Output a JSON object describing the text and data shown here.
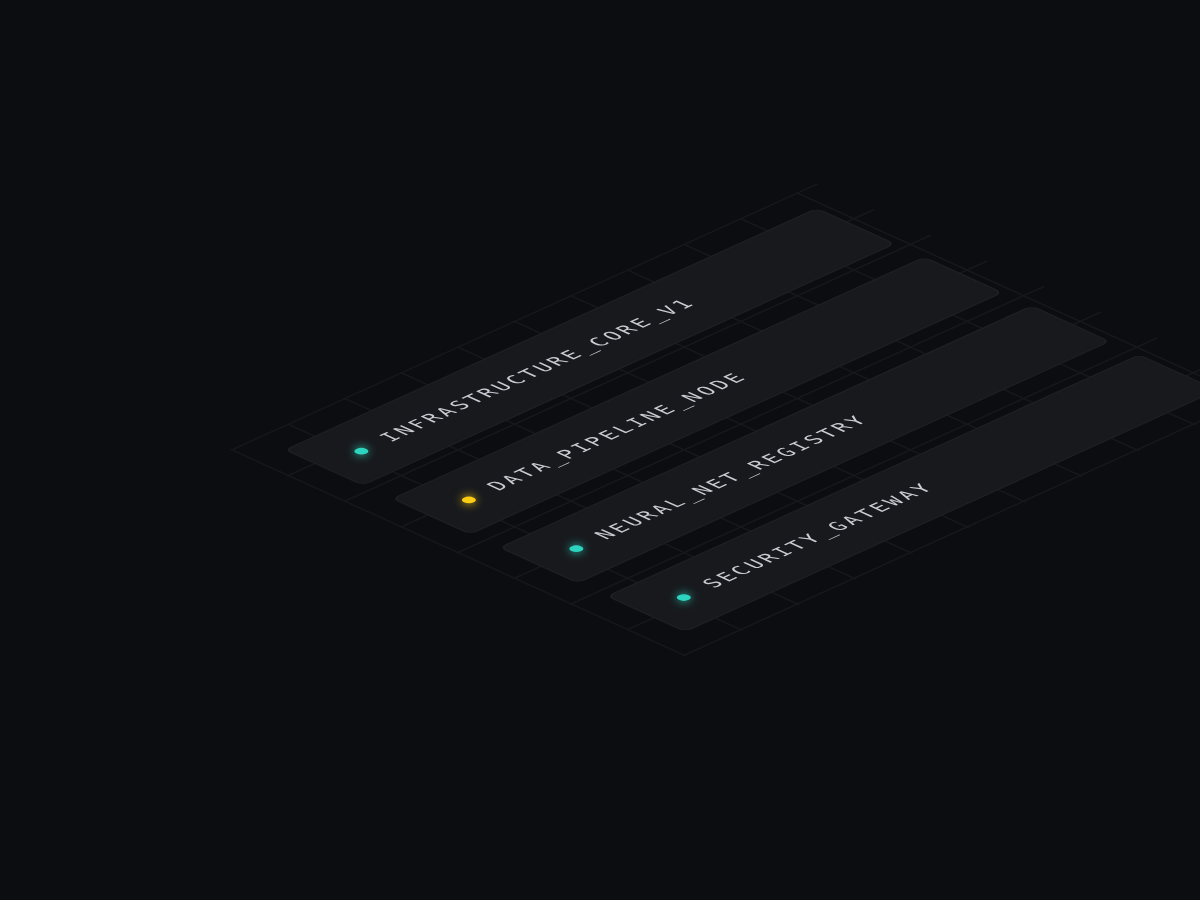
{
  "nodes": [
    {
      "name": "INFRASTRUCTURE_CORE_V1",
      "color": "#2dd4bf"
    },
    {
      "name": "DATA_PIPELINE_NODE",
      "color": "#facc15"
    },
    {
      "name": "NEURAL_NET_REGISTRY",
      "color": "#2dd4bf"
    },
    {
      "name": "SECURITY_GATEWAY",
      "color": "#2dd4bf"
    }
  ]
}
